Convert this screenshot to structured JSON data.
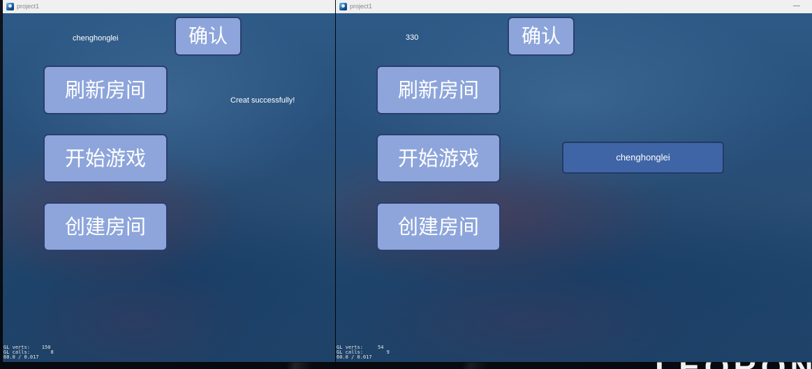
{
  "desktop": {
    "logo_text": "LEORON"
  },
  "windows": [
    {
      "title": "project1",
      "name_text": "chenghonglei",
      "confirm_label": "确认",
      "status_text": "Creat successfully!",
      "buttons": {
        "refresh": "刷新房间",
        "start": "开始游戏",
        "create": "创建房间"
      },
      "stats": {
        "verts_label": "GL verts:",
        "verts": "150",
        "calls_label": "GL calls:",
        "calls": "8",
        "fps": "60.0 / 0.017"
      }
    },
    {
      "title": "project1",
      "minimize_glyph": "—",
      "name_text": "330",
      "confirm_label": "确认",
      "buttons": {
        "refresh": "刷新房间",
        "start": "开始游戏",
        "create": "创建房间"
      },
      "room_list": [
        {
          "name": "chenghonglei"
        }
      ],
      "stats": {
        "verts_label": "GL verts:",
        "verts": "54",
        "calls_label": "GL calls:",
        "calls": "9",
        "fps": "60.0 / 0.017"
      }
    }
  ]
}
